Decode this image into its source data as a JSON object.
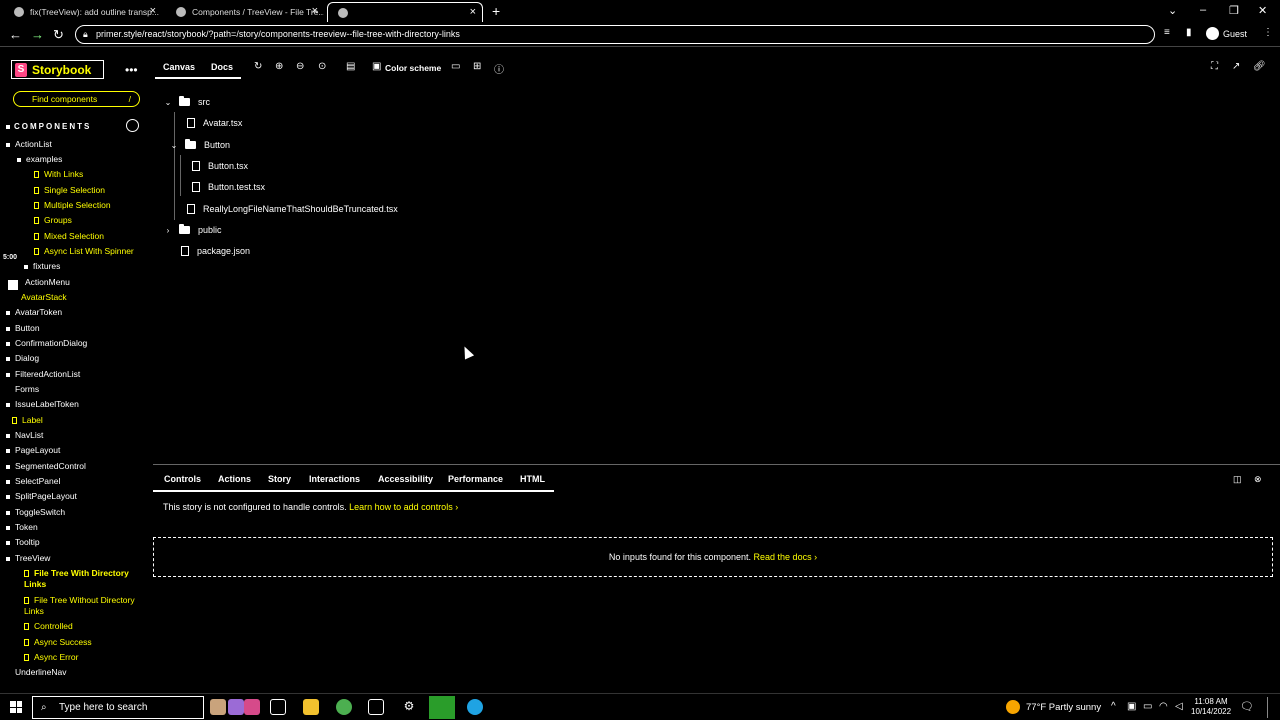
{
  "browser": {
    "tabs": [
      {
        "title": "fix(TreeView): add outline transp..."
      },
      {
        "title": "Components / TreeView - File Tre..."
      },
      {
        "title": ""
      }
    ],
    "url": "primer.style/react/storybook/?path=/story/components-treeview--file-tree-with-directory-links",
    "profile": "Guest"
  },
  "sidebar": {
    "brand": "Storybook",
    "search_placeholder": "Find components",
    "search_shortcut": "/",
    "section_title": "COMPONENTS",
    "items": [
      {
        "label": "ActionList",
        "kind": "component"
      },
      {
        "label": "examples",
        "kind": "folder"
      },
      {
        "label": "With Links",
        "kind": "story"
      },
      {
        "label": "Single Selection",
        "kind": "story"
      },
      {
        "label": "Multiple Selection",
        "kind": "story"
      },
      {
        "label": "Groups",
        "kind": "story"
      },
      {
        "label": "Mixed Selection",
        "kind": "story"
      },
      {
        "label": "Async List With Spinner",
        "kind": "story"
      },
      {
        "label": "fixtures",
        "kind": "folder"
      },
      {
        "label": "ActionMenu",
        "kind": "component"
      },
      {
        "label": "AvatarStack",
        "kind": "story"
      },
      {
        "label": "AvatarToken",
        "kind": "component"
      },
      {
        "label": "Button",
        "kind": "component"
      },
      {
        "label": "ConfirmationDialog",
        "kind": "component"
      },
      {
        "label": "Dialog",
        "kind": "component"
      },
      {
        "label": "FilteredActionList",
        "kind": "component"
      },
      {
        "label": "Forms",
        "kind": "component"
      },
      {
        "label": "IssueLabelToken",
        "kind": "component"
      },
      {
        "label": "Label",
        "kind": "story"
      },
      {
        "label": "NavList",
        "kind": "component"
      },
      {
        "label": "PageLayout",
        "kind": "component"
      },
      {
        "label": "SegmentedControl",
        "kind": "component"
      },
      {
        "label": "SelectPanel",
        "kind": "component"
      },
      {
        "label": "SplitPageLayout",
        "kind": "component"
      },
      {
        "label": "ToggleSwitch",
        "kind": "component"
      },
      {
        "label": "Token",
        "kind": "component"
      },
      {
        "label": "Tooltip",
        "kind": "component"
      },
      {
        "label": "TreeView",
        "kind": "component"
      },
      {
        "label": "File Tree With Directory Links",
        "kind": "story-selected"
      },
      {
        "label": "File Tree Without Directory Links",
        "kind": "story"
      },
      {
        "label": "Controlled",
        "kind": "story"
      },
      {
        "label": "Async Success",
        "kind": "story"
      },
      {
        "label": "Async Error",
        "kind": "story"
      },
      {
        "label": "UnderlineNav",
        "kind": "component"
      }
    ],
    "overlay_time": "5:00"
  },
  "toolbar": {
    "canvas_tab": "Canvas",
    "docs_tab": "Docs",
    "color_scheme": "Color scheme"
  },
  "filetree": {
    "rows": [
      {
        "label": "src",
        "type": "folder",
        "expanded": true
      },
      {
        "label": "Avatar.tsx",
        "type": "file"
      },
      {
        "label": "Button",
        "type": "folder",
        "expanded": true
      },
      {
        "label": "Button.tsx",
        "type": "file"
      },
      {
        "label": "Button.test.tsx",
        "type": "file"
      },
      {
        "label": "ReallyLongFileNameThatShouldBeTruncated.tsx",
        "type": "file"
      },
      {
        "label": "public",
        "type": "folder",
        "expanded": false
      },
      {
        "label": "package.json",
        "type": "file"
      }
    ]
  },
  "panel": {
    "tabs": [
      "Controls",
      "Actions",
      "Story",
      "Interactions",
      "Accessibility",
      "Performance",
      "HTML"
    ],
    "message": "This story is not configured to handle controls.",
    "message_link": "Learn how to add controls",
    "no_inputs": "No inputs found for this component.",
    "no_inputs_link": "Read the docs"
  },
  "taskbar": {
    "search_placeholder": "Type here to search",
    "weather": "77°F  Partly sunny",
    "time": "11:08 AM",
    "date": "10/14/2022"
  }
}
